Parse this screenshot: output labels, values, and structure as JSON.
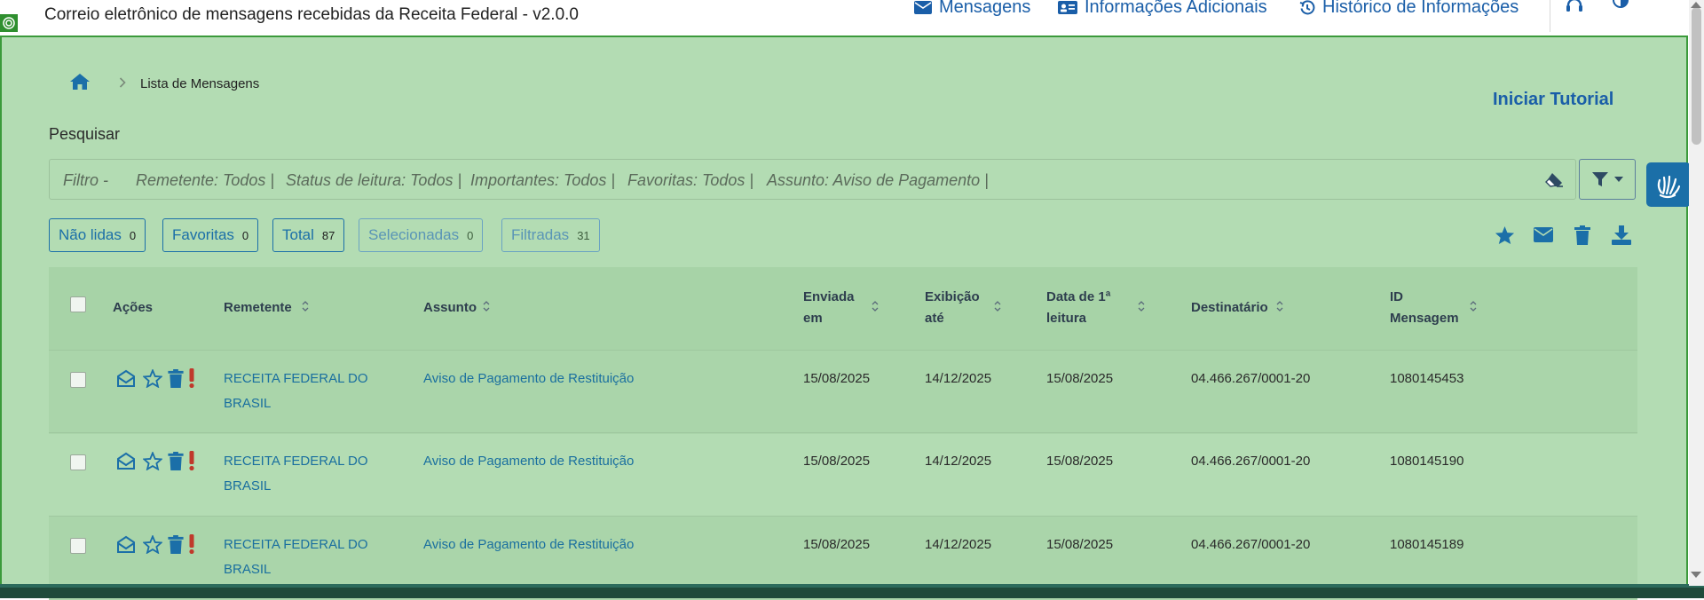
{
  "header": {
    "title": "Correio eletrônico de mensagens recebidas da Receita Federal - v2.0.0",
    "nav": [
      {
        "label": "Mensagens",
        "icon": "envelope-icon"
      },
      {
        "label": "Informações Adicionais",
        "icon": "id-card-icon"
      },
      {
        "label": "Histórico de Informações",
        "icon": "history-icon"
      }
    ],
    "icons": [
      "headset-icon",
      "contrast-icon"
    ]
  },
  "breadcrumb": {
    "current": "Lista de Mensagens"
  },
  "tutorial_label": "Iniciar Tutorial",
  "search": {
    "label": "Pesquisar",
    "filters": [
      "Filtro -",
      "Remetente: Todos |",
      "Status de leitura: Todos |",
      "Importantes: Todos |",
      "Favoritas: Todos |",
      "Assunto: Aviso de Pagamento |"
    ]
  },
  "tabs": [
    {
      "label": "Não lidas",
      "count": "0"
    },
    {
      "label": "Favoritas",
      "count": "0"
    },
    {
      "label": "Total",
      "count": "87"
    },
    {
      "label": "Selecionadas",
      "count": "0"
    },
    {
      "label": "Filtradas",
      "count": "31"
    }
  ],
  "table": {
    "headers": {
      "acoes": "Ações",
      "remetente": "Remetente",
      "assunto": "Assunto",
      "enviada": [
        "Enviada",
        "em"
      ],
      "exibicao": [
        "Exibição",
        "até"
      ],
      "leitura": [
        "Data de 1ª",
        "leitura"
      ],
      "destinatario": "Destinatário",
      "id": [
        "ID",
        "Mensagem"
      ]
    },
    "rows": [
      {
        "remetente": [
          "RECEITA FEDERAL DO",
          "BRASIL"
        ],
        "assunto": "Aviso de Pagamento de Restituição",
        "enviada": "15/08/2025",
        "exibicao": "14/12/2025",
        "leitura": "15/08/2025",
        "destinatario": "04.466.267/0001-20",
        "id": "1080145453"
      },
      {
        "remetente": [
          "RECEITA FEDERAL DO",
          "BRASIL"
        ],
        "assunto": "Aviso de Pagamento de Restituição",
        "enviada": "15/08/2025",
        "exibicao": "14/12/2025",
        "leitura": "15/08/2025",
        "destinatario": "04.466.267/0001-20",
        "id": "1080145190"
      },
      {
        "remetente": [
          "RECEITA FEDERAL DO",
          "BRASIL"
        ],
        "assunto": "Aviso de Pagamento de Restituição",
        "enviada": "15/08/2025",
        "exibicao": "14/12/2025",
        "leitura": "15/08/2025",
        "destinatario": "04.466.267/0001-20",
        "id": "1080145189"
      }
    ]
  },
  "colors": {
    "accent": "#1b6fa8",
    "panel": "#b3dcb3",
    "danger": "#c0392b"
  }
}
